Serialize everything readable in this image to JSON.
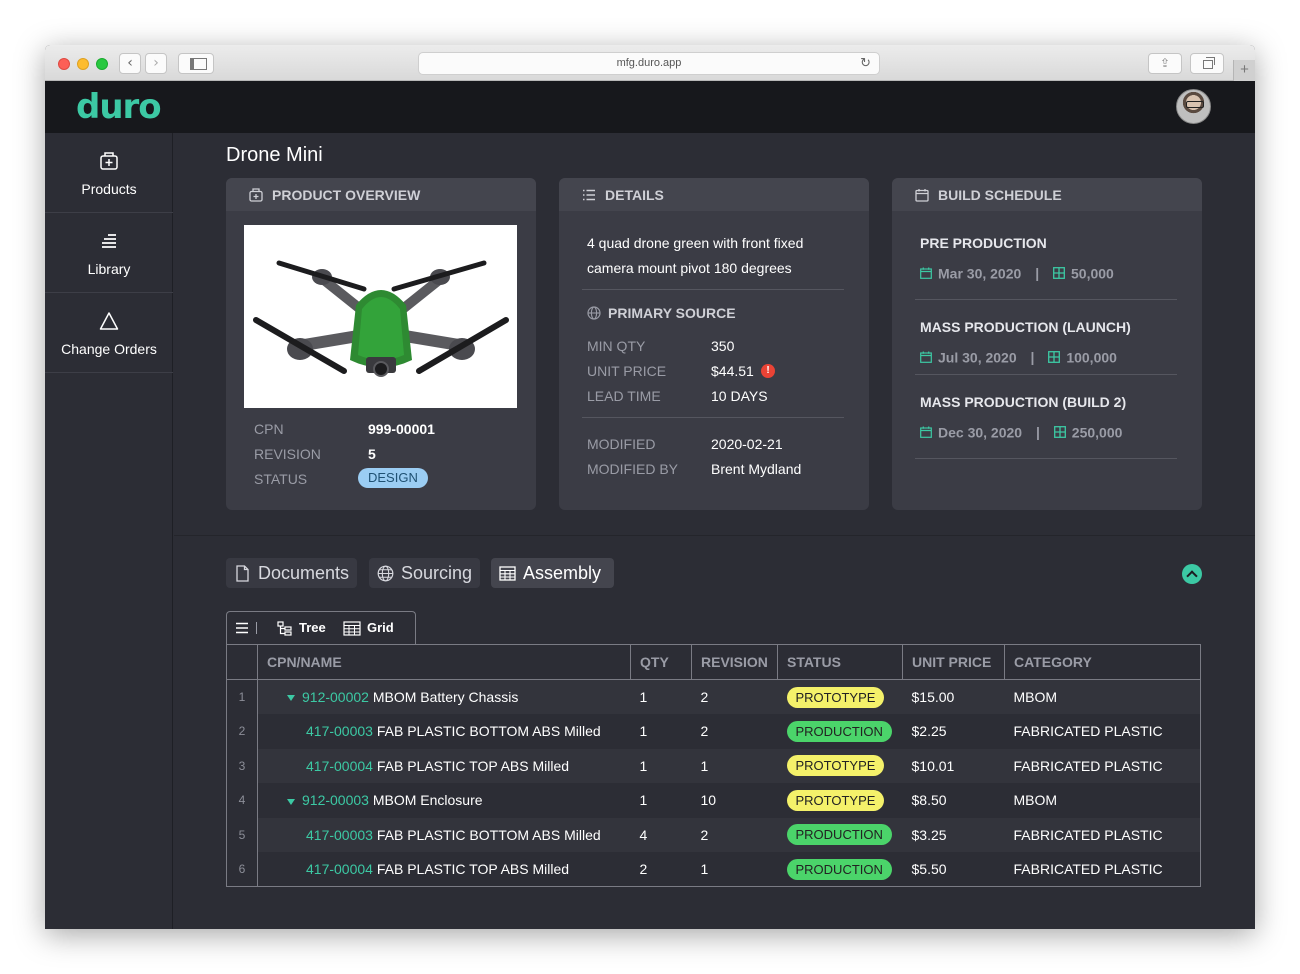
{
  "browser": {
    "url": "mfg.duro.app",
    "back_glyph": "‹",
    "forward_glyph": "›",
    "reload_glyph": "↻",
    "share_glyph": "⇪",
    "newtab_glyph": "+"
  },
  "app": {
    "logo": "duro"
  },
  "sidebar": {
    "items": [
      {
        "label": "Products",
        "icon": "product-box-icon"
      },
      {
        "label": "Library",
        "icon": "library-stack-icon"
      },
      {
        "label": "Change Orders",
        "icon": "triangle-icon"
      }
    ]
  },
  "page": {
    "title": "Drone Mini"
  },
  "overview": {
    "title": "PRODUCT OVERVIEW",
    "image_alt": "drone-product-image",
    "cpn_label": "CPN",
    "cpn": "999-00001",
    "revision_label": "REVISION",
    "revision": "5",
    "status_label": "STATUS",
    "status": "DESIGN"
  },
  "details": {
    "title": "DETAILS",
    "description": "4 quad drone green with front fixed camera mount pivot 180 degrees",
    "primary_source_title": "PRIMARY SOURCE",
    "min_qty_label": "MIN QTY",
    "min_qty": "350",
    "unit_price_label": "UNIT PRICE",
    "unit_price": "$44.51",
    "unit_price_alert": "!",
    "lead_time_label": "LEAD TIME",
    "lead_time": "10 DAYS",
    "modified_label": "MODIFIED",
    "modified": "2020-02-21",
    "modified_by_label": "MODIFIED BY",
    "modified_by": "Brent Mydland"
  },
  "schedule": {
    "title": "BUILD SCHEDULE",
    "separator": "|",
    "items": [
      {
        "name": "PRE PRODUCTION",
        "date": "Mar 30, 2020",
        "qty": "50,000"
      },
      {
        "name": "MASS PRODUCTION (LAUNCH)",
        "date": "Jul 30, 2020",
        "qty": "100,000"
      },
      {
        "name": "MASS PRODUCTION (BUILD 2)",
        "date": "Dec 30, 2020",
        "qty": "250,000"
      }
    ]
  },
  "tabs": [
    {
      "label": "Documents",
      "icon": "document-icon"
    },
    {
      "label": "Sourcing",
      "icon": "globe-icon"
    },
    {
      "label": "Assembly",
      "icon": "table-icon",
      "active": true
    }
  ],
  "view_toggle": {
    "tree_label": "Tree",
    "grid_label": "Grid"
  },
  "table": {
    "columns": [
      "CPN/NAME",
      "QTY",
      "REVISION",
      "STATUS",
      "UNIT PRICE",
      "CATEGORY"
    ],
    "rows": [
      {
        "num": "1",
        "cpn": "912-00002",
        "name": "MBOM Battery Chassis",
        "qty": "1",
        "revision": "2",
        "status": "PROTOTYPE",
        "price": "$15.00",
        "category": "MBOM"
      },
      {
        "num": "2",
        "cpn": "417-00003",
        "name": "FAB PLASTIC BOTTOM ABS Milled",
        "qty": "1",
        "revision": "2",
        "status": "PRODUCTION",
        "price": "$2.25",
        "category": "FABRICATED PLASTIC"
      },
      {
        "num": "3",
        "cpn": "417-00004",
        "name": "FAB PLASTIC TOP ABS Milled",
        "qty": "1",
        "revision": "1",
        "status": "PROTOTYPE",
        "price": "$10.01",
        "category": "FABRICATED PLASTIC"
      },
      {
        "num": "4",
        "cpn": "912-00003",
        "name": "MBOM Enclosure",
        "qty": "1",
        "revision": "10",
        "status": "PROTOTYPE",
        "price": "$8.50",
        "category": "MBOM"
      },
      {
        "num": "5",
        "cpn": "417-00003",
        "name": "FAB PLASTIC BOTTOM ABS Milled",
        "qty": "4",
        "revision": "2",
        "status": "PRODUCTION",
        "price": "$3.25",
        "category": "FABRICATED PLASTIC"
      },
      {
        "num": "6",
        "cpn": "417-00004",
        "name": "FAB PLASTIC TOP ABS Milled",
        "qty": "2",
        "revision": "1",
        "status": "PRODUCTION",
        "price": "$5.50",
        "category": "FABRICATED PLASTIC"
      }
    ]
  },
  "colors": {
    "accent": "#3cc9a4",
    "prototype": "#f4f16a",
    "production": "#4bd46a",
    "design": "#9bcdf3",
    "background": "#2c2d35"
  }
}
